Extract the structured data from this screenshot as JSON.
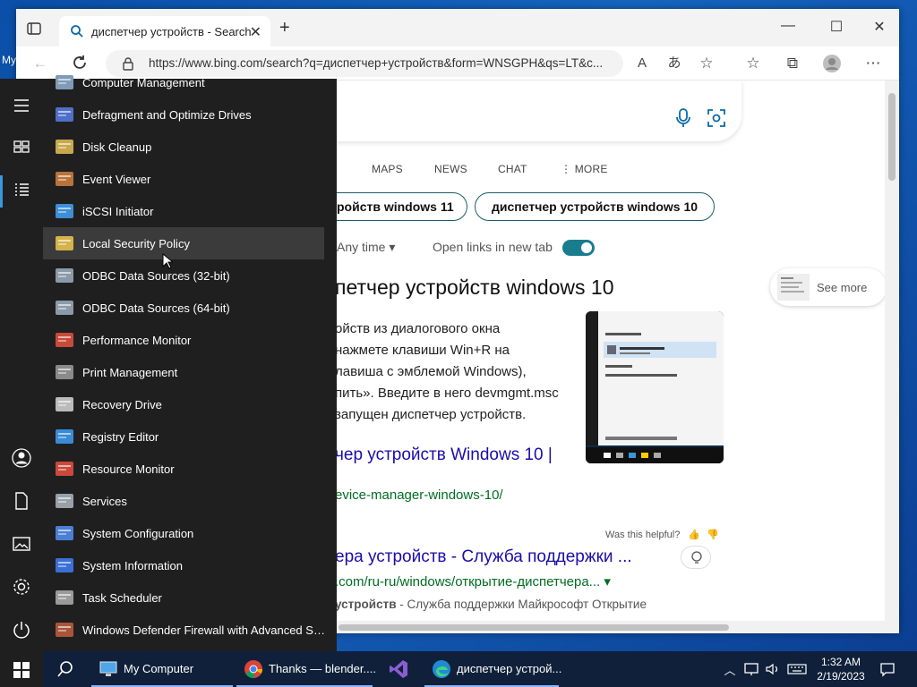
{
  "desktop": {
    "label": "My"
  },
  "browser": {
    "tab_title": "диспетчер устройств - Search",
    "url": "https://www.bing.com/search?q=диспетчер+устройств&form=WNSGPH&qs=LT&c...",
    "nav": [
      "MAPS",
      "NEWS",
      "CHAT",
      "⋮ MORE"
    ],
    "chips": [
      "ройств windows 11",
      "диспетчер устройств windows 10"
    ],
    "filter_time": "Any time ▾",
    "open_links_label": "Open links in new tab",
    "answer": {
      "title": "петчер устройств windows 10",
      "lines": [
        "ойств из диалогового окна",
        "нажмете клавиши Win+R на",
        "лавиша с эмблемой Windows),",
        "пить». Введите в него devmgmt.msc",
        "запущен диспетчер устройств."
      ],
      "link": "чер устройств Windows 10 |",
      "url": "evice-manager-windows-10/"
    },
    "helpful": "Was this helpful?",
    "see_more": "See more",
    "result2": {
      "title": "ера устройств - Служба поддержки ...",
      "url": ".com/ru-ru/windows/открытие-диспетчера... ▾",
      "snippet_bold": "устройств",
      "snippet": " - Служба поддержки Майкрософт Открытие"
    }
  },
  "start_menu": {
    "apps": [
      {
        "label": "Computer Management",
        "icon": "computer-management-icon"
      },
      {
        "label": "Defragment and Optimize Drives",
        "icon": "defragment-icon"
      },
      {
        "label": "Disk Cleanup",
        "icon": "disk-cleanup-icon"
      },
      {
        "label": "Event Viewer",
        "icon": "event-viewer-icon"
      },
      {
        "label": "iSCSI Initiator",
        "icon": "iscsi-icon"
      },
      {
        "label": "Local Security Policy",
        "icon": "security-policy-icon"
      },
      {
        "label": "ODBC Data Sources (32-bit)",
        "icon": "odbc-icon"
      },
      {
        "label": "ODBC Data Sources (64-bit)",
        "icon": "odbc-icon"
      },
      {
        "label": "Performance Monitor",
        "icon": "performance-monitor-icon"
      },
      {
        "label": "Print Management",
        "icon": "print-management-icon"
      },
      {
        "label": "Recovery Drive",
        "icon": "recovery-drive-icon"
      },
      {
        "label": "Registry Editor",
        "icon": "registry-editor-icon"
      },
      {
        "label": "Resource Monitor",
        "icon": "resource-monitor-icon"
      },
      {
        "label": "Services",
        "icon": "services-icon"
      },
      {
        "label": "System Configuration",
        "icon": "system-configuration-icon"
      },
      {
        "label": "System Information",
        "icon": "system-information-icon"
      },
      {
        "label": "Task Scheduler",
        "icon": "task-scheduler-icon"
      },
      {
        "label": "Windows Defender Firewall with Advanced Securi...",
        "icon": "firewall-icon"
      }
    ]
  },
  "taskbar": {
    "items": [
      {
        "label": "My Computer",
        "icon": "my-computer-icon"
      },
      {
        "label": "Thanks — blender....",
        "icon": "chrome-icon"
      },
      {
        "label": "",
        "icon": "visual-studio-icon"
      },
      {
        "label": "диспетчер устрой...",
        "icon": "edge-icon"
      }
    ],
    "time": "1:32 AM",
    "date": "2/19/2023"
  },
  "colors": {
    "accent": "#3a96dd",
    "toggle": "#1a7d8f",
    "link": "#1a0dab",
    "url": "#006d21"
  }
}
